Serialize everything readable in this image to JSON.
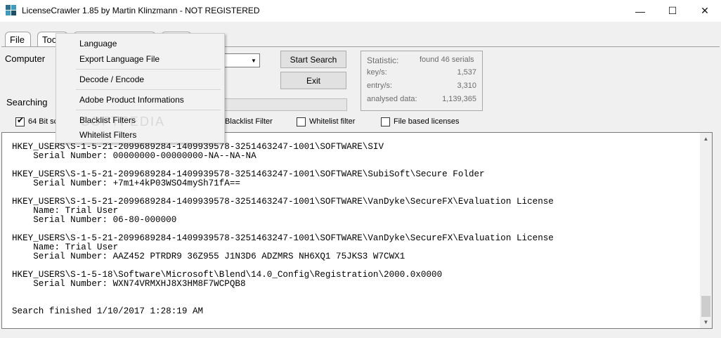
{
  "window": {
    "title": "LicenseCrawler 1.85 by Martin Klinzmann - NOT REGISTERED",
    "minimize_glyph": "—",
    "maximize_glyph": "☐",
    "close_glyph": "✕"
  },
  "tabs": [
    {
      "label": "File"
    },
    {
      "label": "Too"
    }
  ],
  "labels": {
    "computer": "Computer",
    "searching": "Searching"
  },
  "buttons": {
    "start_search": "Start Search",
    "exit": "Exit"
  },
  "statistic": {
    "title": "Statistic:",
    "found": "found 46 serials",
    "keys_label": "key/s:",
    "keys_value": "1,537",
    "entry_label": "entry/s:",
    "entry_value": "3,310",
    "analysed_label": "analysed data:",
    "analysed_value": "1,139,365"
  },
  "options": {
    "bit64_label": "64 Bit sc",
    "bit64_checked": true,
    "blacklist_label": "Blacklist Filter",
    "whitelist_label": "Whitelist filter",
    "whitelist_checked": false,
    "filebased_label": "File based licenses",
    "filebased_checked": false
  },
  "menu": {
    "items": [
      "Language",
      "Export Language File",
      "Decode / Encode",
      "Adobe Product Informations",
      "Blacklist Filters",
      "Whitelist Filters"
    ]
  },
  "output": {
    "text": "HKEY_USERS\\S-1-5-21-2099689284-1409939578-3251463247-1001\\SOFTWARE\\SIV\n    Serial Number: 00000000-00000000-NA--NA-NA\n\nHKEY_USERS\\S-1-5-21-2099689284-1409939578-3251463247-1001\\SOFTWARE\\SubiSoft\\Secure Folder\n    Serial Number: +7m1+4kP03WSO4mySh71fA==\n\nHKEY_USERS\\S-1-5-21-2099689284-1409939578-3251463247-1001\\SOFTWARE\\VanDyke\\SecureFX\\Evaluation License\n    Name: Trial User\n    Serial Number: 06-80-000000\n\nHKEY_USERS\\S-1-5-21-2099689284-1409939578-3251463247-1001\\SOFTWARE\\VanDyke\\SecureFX\\Evaluation License\n    Name: Trial User\n    Serial Number: AAZ452 PTRDR9 36Z955 J1N3D6 ADZMRS NH6XQ1 75JKS3 W7CWX1\n\nHKEY_USERS\\S-1-5-18\\Software\\Microsoft\\Blend\\14.0_Config\\Registration\\2000.0x0000\n    Serial Number: WXN74VRMXHJ8X3HM8F7WCPQB8\n\n\nSearch finished 1/10/2017 1:28:19 AM"
  },
  "scrollbar": {
    "up_glyph": "▲",
    "down_glyph": "▼"
  },
  "watermark": "SOFTPEDIA"
}
